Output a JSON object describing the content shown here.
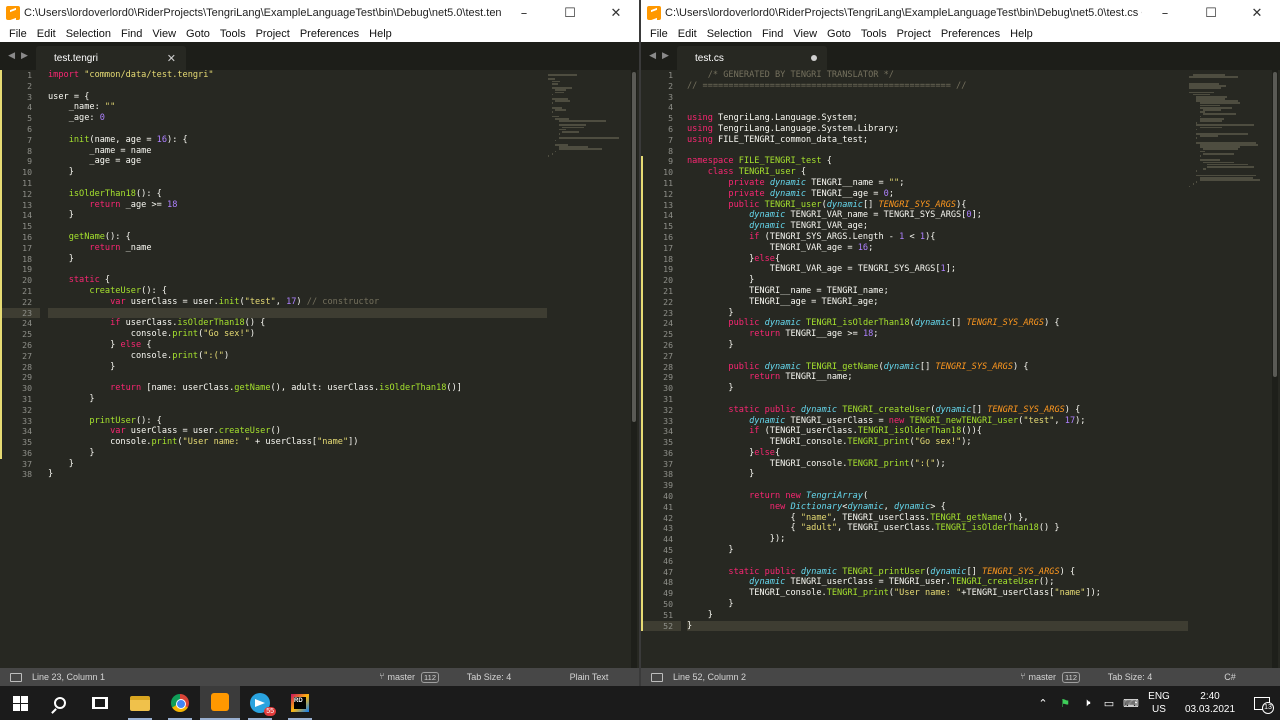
{
  "left_window": {
    "title": "C:\\Users\\lordoverlord0\\RiderProjects\\TengriLang\\ExampleLanguageTest\\bin\\Debug\\net5.0\\test.tengri - Sublim...",
    "controls": {
      "minimize": "–",
      "maximize": "☐",
      "close": "✕"
    },
    "menu": [
      "File",
      "Edit",
      "Selection",
      "Find",
      "View",
      "Goto",
      "Tools",
      "Project",
      "Preferences",
      "Help"
    ],
    "tab": {
      "label": "test.tengri",
      "close": "✕"
    },
    "status": {
      "position": "Line 23, Column 1",
      "branch": "master",
      "changes": "112",
      "tab_size": "Tab Size: 4",
      "syntax": "Plain Text"
    },
    "code": [
      "import \"common/data/test.tengri\"",
      "",
      "user = {",
      "    _name: \"\"",
      "    _age: 0",
      "",
      "    init(name, age = 16): {",
      "        _name = name",
      "        _age = age",
      "    }",
      "",
      "    isOlderThan18(): {",
      "        return _age >= 18",
      "    }",
      "",
      "    getName(): {",
      "        return _name",
      "    }",
      "",
      "    static {",
      "        createUser(): {",
      "            var userClass = user.init(\"test\", 17) // constructor",
      "",
      "            if userClass.isOlderThan18() {",
      "                console.print(\"Go sex!\")",
      "            } else {",
      "                console.print(\":(\")",
      "            }",
      "",
      "            return [name: userClass.getName(), adult: userClass.isOlderThan18()]",
      "        }",
      "",
      "        printUser(): {",
      "            var userClass = user.createUser()",
      "            console.print(\"User name: \" + userClass[\"name\"])",
      "        }",
      "    }",
      "}"
    ]
  },
  "right_window": {
    "title": "C:\\Users\\lordoverlord0\\RiderProjects\\TengriLang\\ExampleLanguageTest\\bin\\Debug\\net5.0\\test.cs • - Sublime T...",
    "controls": {
      "minimize": "–",
      "maximize": "☐",
      "close": "✕"
    },
    "menu": [
      "File",
      "Edit",
      "Selection",
      "Find",
      "View",
      "Goto",
      "Tools",
      "Project",
      "Preferences",
      "Help"
    ],
    "tab": {
      "label": "test.cs"
    },
    "status": {
      "position": "Line 52, Column 2",
      "branch": "master",
      "changes": "112",
      "tab_size": "Tab Size: 4",
      "syntax": "C#"
    },
    "code": [
      "    /* GENERATED BY TENGRI TRANSLATOR */",
      "// ================================================ //",
      "",
      "",
      "using TengriLang.Language.System;",
      "using TengriLang.Language.System.Library;",
      "using FILE_TENGRI_common_data_test;",
      "",
      "namespace FILE_TENGRI_test {",
      "    class TENGRI_user {",
      "        private dynamic TENGRI__name = \"\";",
      "        private dynamic TENGRI__age = 0;",
      "        public TENGRI_user(dynamic[] TENGRI_SYS_ARGS){",
      "            dynamic TENGRI_VAR_name = TENGRI_SYS_ARGS[0];",
      "            dynamic TENGRI_VAR_age;",
      "            if (TENGRI_SYS_ARGS.Length - 1 < 1){",
      "                TENGRI_VAR_age = 16;",
      "            }else{",
      "                TENGRI_VAR_age = TENGRI_SYS_ARGS[1];",
      "            }",
      "            TENGRI__name = TENGRI_name;",
      "            TENGRI__age = TENGRI_age;",
      "        }",
      "        public dynamic TENGRI_isOlderThan18(dynamic[] TENGRI_SYS_ARGS) {",
      "            return TENGRI__age >= 18;",
      "        }",
      "",
      "        public dynamic TENGRI_getName(dynamic[] TENGRI_SYS_ARGS) {",
      "            return TENGRI__name;",
      "        }",
      "",
      "        static public dynamic TENGRI_createUser(dynamic[] TENGRI_SYS_ARGS) {",
      "            dynamic TENGRI_userClass = new TENGRI_newTENGRI_user(\"test\", 17);",
      "            if (TENGRI_userClass.TENGRI_isOlderThan18()){",
      "                TENGRI_console.TENGRI_print(\"Go sex!\");",
      "            }else{",
      "                TENGRI_console.TENGRI_print(\":(\");",
      "            }",
      "",
      "            return new TengriArray(",
      "                new Dictionary<dynamic, dynamic> {",
      "                    { \"name\", TENGRI_userClass.TENGRI_getName() },",
      "                    { \"adult\", TENGRI_userClass.TENGRI_isOlderThan18() }",
      "                });",
      "        }",
      "",
      "        static public dynamic TENGRI_printUser(dynamic[] TENGRI_SYS_ARGS) {",
      "            dynamic TENGRI_userClass = TENGRI_user.TENGRI_createUser();",
      "            TENGRI_console.TENGRI_print(\"User name: \"+TENGRI_userClass[\"name\"]);",
      "        }",
      "    }",
      "}"
    ]
  },
  "taskbar": {
    "apps": [
      "windows-start",
      "search",
      "task-view",
      "file-explorer",
      "chrome",
      "sublime-text",
      "telegram",
      "rider"
    ],
    "telegram_badge": "55",
    "tray_icons": [
      "chevron-up",
      "network-share",
      "volume",
      "battery",
      "keyboard"
    ],
    "language": [
      "ENG",
      "US"
    ],
    "time": "2:40",
    "date": "03.03.2021",
    "notifications": "13"
  },
  "theme": {
    "background": "#272822",
    "keyword": "#f92672",
    "type": "#66d9ef",
    "function": "#a6e22e",
    "string": "#e6db74",
    "number": "#ae81ff",
    "comment": "#75715e"
  }
}
